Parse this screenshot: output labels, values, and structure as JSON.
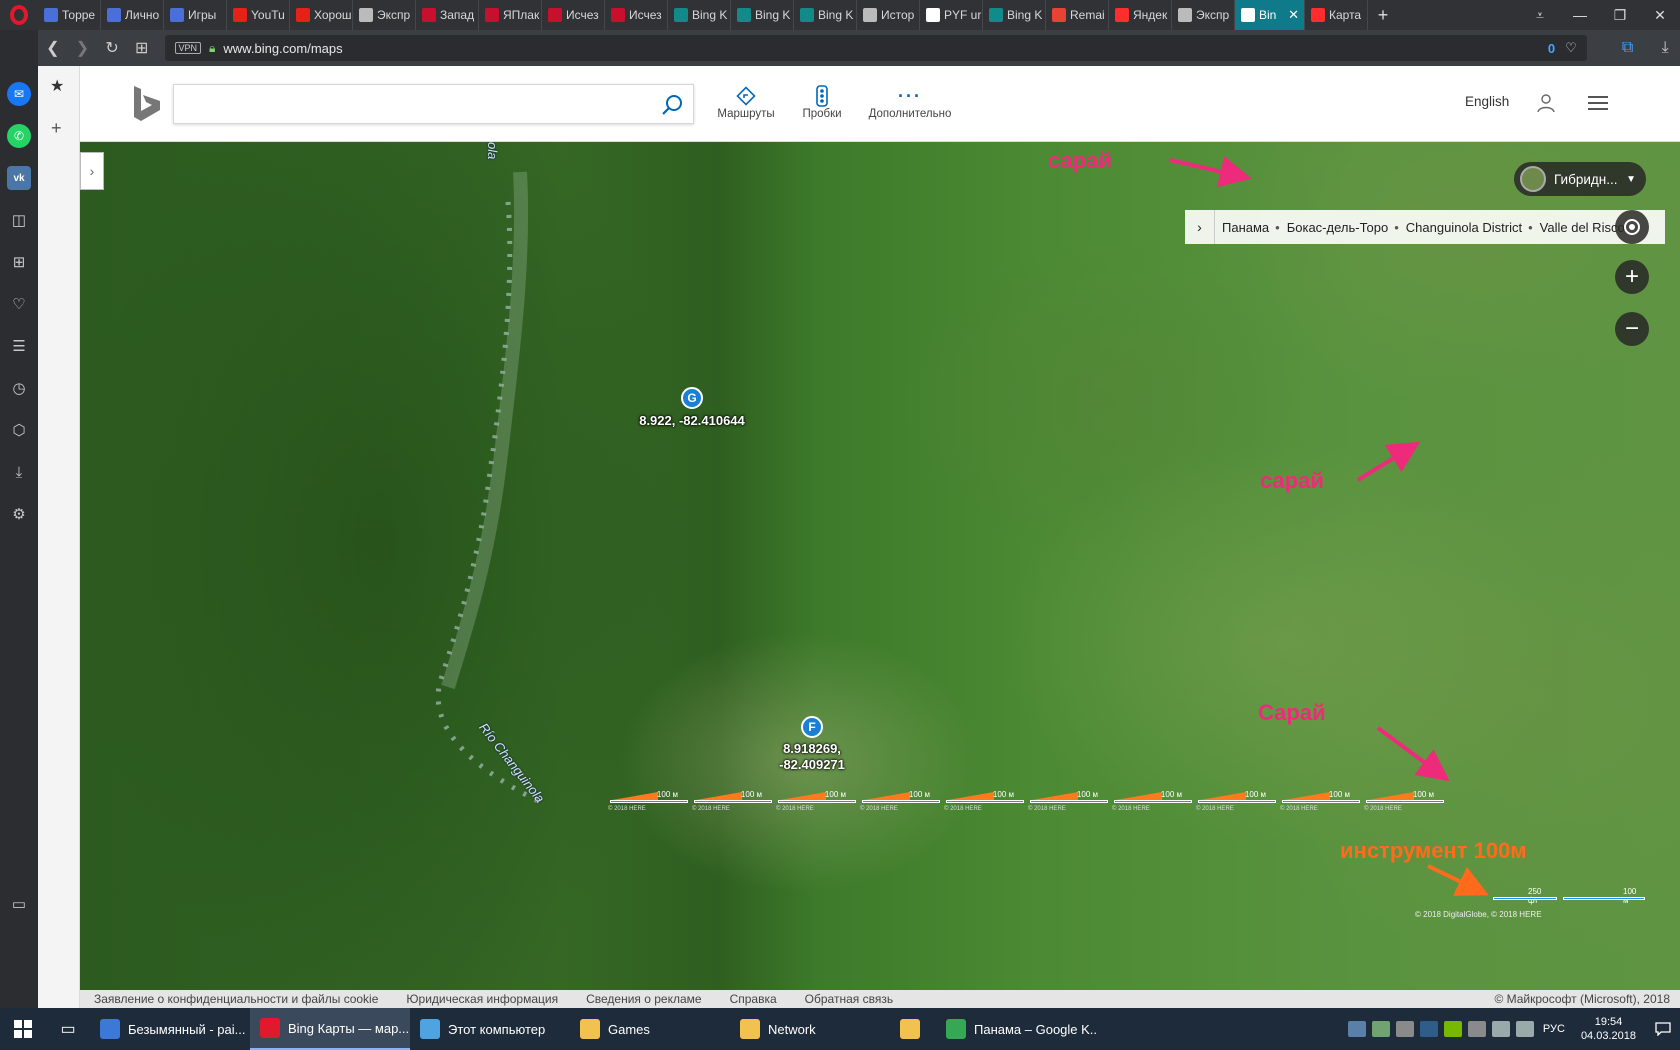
{
  "browser": {
    "tabs": [
      {
        "title": "Торре",
        "icon_color": "#4a6fd6"
      },
      {
        "title": "Лично",
        "icon_color": "#4a6fd6"
      },
      {
        "title": "Игры",
        "icon_color": "#4a6fd6"
      },
      {
        "title": "YouTu",
        "icon_color": "#e62117"
      },
      {
        "title": "Хорош",
        "icon_color": "#e62117"
      },
      {
        "title": "Экспр",
        "icon_color": "#bbbbbb"
      },
      {
        "title": "Запад",
        "icon_color": "#c8102e"
      },
      {
        "title": "ЯПлак",
        "icon_color": "#c8102e"
      },
      {
        "title": "Исчез",
        "icon_color": "#c8102e"
      },
      {
        "title": "Исчез",
        "icon_color": "#c8102e"
      },
      {
        "title": "Bing K",
        "icon_color": "#138a8a"
      },
      {
        "title": "Bing K",
        "icon_color": "#138a8a"
      },
      {
        "title": "Bing K",
        "icon_color": "#138a8a"
      },
      {
        "title": "Истор",
        "icon_color": "#bbbbbb"
      },
      {
        "title": "PYF ur",
        "icon_color": "#ffffff"
      },
      {
        "title": "Bing K",
        "icon_color": "#138a8a"
      },
      {
        "title": "Remai",
        "icon_color": "#e94235"
      },
      {
        "title": "Яндек",
        "icon_color": "#ff2d2d"
      },
      {
        "title": "Экспр",
        "icon_color": "#bbbbbb"
      },
      {
        "title": "Bin",
        "icon_color": "#ffffff",
        "active": true
      },
      {
        "title": "Карта",
        "icon_color": "#ff2d2d"
      }
    ],
    "url": "www.bing.com/maps",
    "vpn_label": "VPN",
    "adblock_count": "0"
  },
  "bing": {
    "search_placeholder": "",
    "buttons": [
      {
        "label": "Маршруты",
        "icon": "directions-icon"
      },
      {
        "label": "Пробки",
        "icon": "traffic-icon"
      },
      {
        "label": "Дополнительно",
        "icon": "more-icon"
      }
    ],
    "language": "English"
  },
  "map": {
    "style_label": "Гибридн...",
    "breadcrumbs": [
      "Панама",
      "Бокас-дель-Торо",
      "Changuinola District",
      "Valle del Risco"
    ],
    "river_label_top": "ola",
    "river_label": "Río Changuinola",
    "pins": [
      {
        "letter": "G",
        "label": "8.922, -82.410644"
      },
      {
        "letter": "F",
        "label_line1": "8.918269,",
        "label_line2": "-82.409271"
      }
    ],
    "annotations": {
      "barn1": "сарай",
      "barn2": "сарай",
      "barn3": "Сарай",
      "tool": "инструмент 100м"
    },
    "scale_tool_label": "100 м",
    "scale_tool_copyright": "© 2018 HERE",
    "scale_tool_count": 10,
    "scale_left": "250 фт",
    "scale_right": "100 м",
    "imagery_copyright": "© 2018 DigitalGlobe, © 2018 HERE"
  },
  "footer": {
    "links": [
      "Заявление о конфиденциальности и файлы cookie",
      "Юридическая информация",
      "Сведения о рекламе",
      "Справка",
      "Обратная связь"
    ],
    "copyright": "© Майкрософт (Microsoft), 2018"
  },
  "taskbar": {
    "items": [
      {
        "label": "Безымянный - pai...",
        "icon_color": "#3c78d8"
      },
      {
        "label": "Bing Карты — мар...",
        "icon_color": "#e0192c",
        "active": true
      },
      {
        "label": "Этот компьютер",
        "icon_color": "#4fa3e0"
      },
      {
        "label": "Games",
        "icon_color": "#f2c14e"
      },
      {
        "label": "Network",
        "icon_color": "#f2c14e"
      },
      {
        "label": "",
        "icon_color": "#f2c14e"
      },
      {
        "label": "Панама – Google K...",
        "icon_color": "#34a853"
      }
    ],
    "lang": "РУС",
    "time": "19:54",
    "date": "04.03.2018"
  }
}
